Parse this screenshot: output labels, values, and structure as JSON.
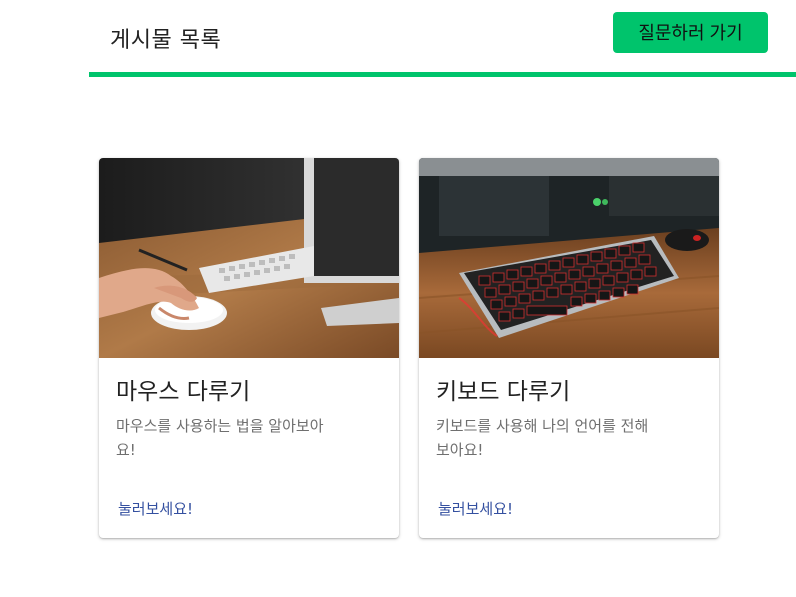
{
  "header": {
    "title": "게시물 목록",
    "ask_button_label": "질문하러 가기",
    "accent_color": "#00c46c"
  },
  "cards": [
    {
      "title": "마우스 다루기",
      "description": "마우스를 사용하는 법을 알아보아요!",
      "link_label": "눌러보세요!",
      "image": "photo of a hand using a white mouse at a desk"
    },
    {
      "title": "키보드 다루기",
      "description": "키보드를 사용해 나의 언어를 전해보아요!",
      "link_label": "눌러보세요!",
      "image": "photo of a mechanical keyboard with red backlight on a wooden desk"
    }
  ]
}
